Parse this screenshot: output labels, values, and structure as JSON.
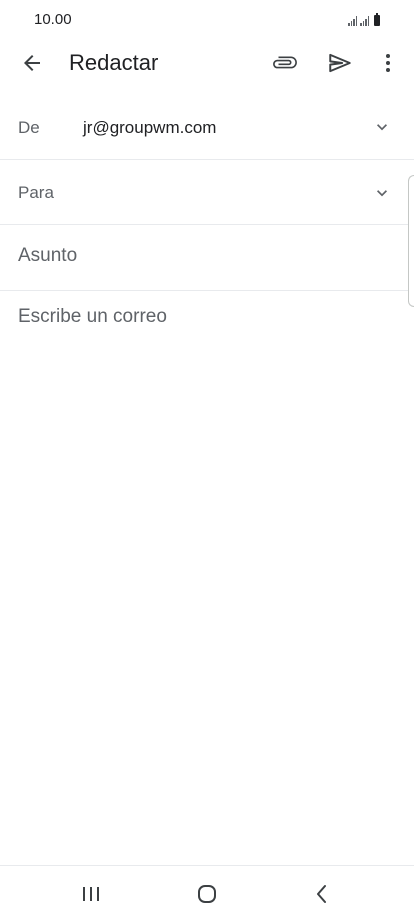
{
  "status_bar": {
    "time": "10.00"
  },
  "app_bar": {
    "title": "Redactar",
    "icons": {
      "back": "arrow-back-icon",
      "attach": "paperclip-icon",
      "send": "send-icon",
      "more": "more-vert-icon"
    }
  },
  "compose": {
    "from_label": "De",
    "from_value": "jr@groupwm.com",
    "to_label": "Para",
    "subject_placeholder": "Asunto",
    "body_placeholder": "Escribe un correo"
  },
  "colors": {
    "text_primary": "#202124",
    "text_secondary": "#5f6368",
    "divider": "#e8eaed"
  },
  "nav_bar": {
    "icons": [
      "recents-icon",
      "home-icon",
      "nav-back-icon"
    ]
  }
}
